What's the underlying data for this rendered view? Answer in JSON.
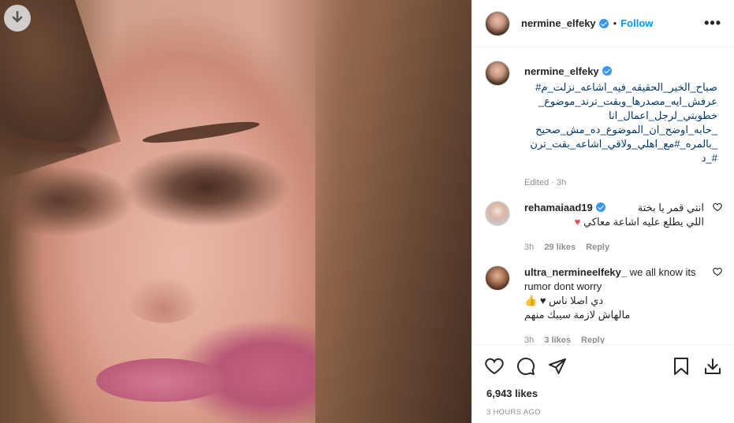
{
  "post": {
    "username": "nermine_elfeky",
    "follow_label": "Follow",
    "more_label": "•••",
    "dot": "•",
    "caption_lines": [
      "صباح_الخير_الحقيقه_فيه_اشاعه_نزلت_م#",
      "عرفش_ايه_مصدرها_وبقت_ترند_موضوع_",
      "خطوبتي_لرجل_اعمال_انا",
      "_حابه_اوضح_ان_الموضوع_ده_مش_صحيح",
      "_بالمره_#مع_اهلي_ولاقي_اشاعه_بقت_ترن",
      "#_د"
    ],
    "edited": "Edited · 3h"
  },
  "comments": [
    {
      "username": "rehamaiaad19",
      "text_line1": "انتي قمر يا بختة",
      "text_line2": "اللي يطلع عليه اشاعة معاكي",
      "heart": "♥",
      "time": "3h",
      "likes": "29 likes",
      "reply": "Reply"
    },
    {
      "username": "ultra_nermineelfeky_",
      "text_en": "we all know its rumor dont worry",
      "text_line2": "دي اصلا ناس ♥",
      "text_line3": "مالهاش لازمة سيبك منهم",
      "thumb": "👍",
      "time": "3h",
      "likes": "3 likes",
      "reply": "Reply"
    }
  ],
  "footer": {
    "likes": "6,943 likes",
    "time_ago": "3 HOURS AGO"
  },
  "colors": {
    "accent": "#0095f6",
    "verified": "#3897f0",
    "heart": "#ed4956"
  },
  "icons": [
    "download-icon",
    "verified-icon",
    "more-icon",
    "heart-icon",
    "comment-icon",
    "share-icon",
    "bookmark-icon"
  ]
}
